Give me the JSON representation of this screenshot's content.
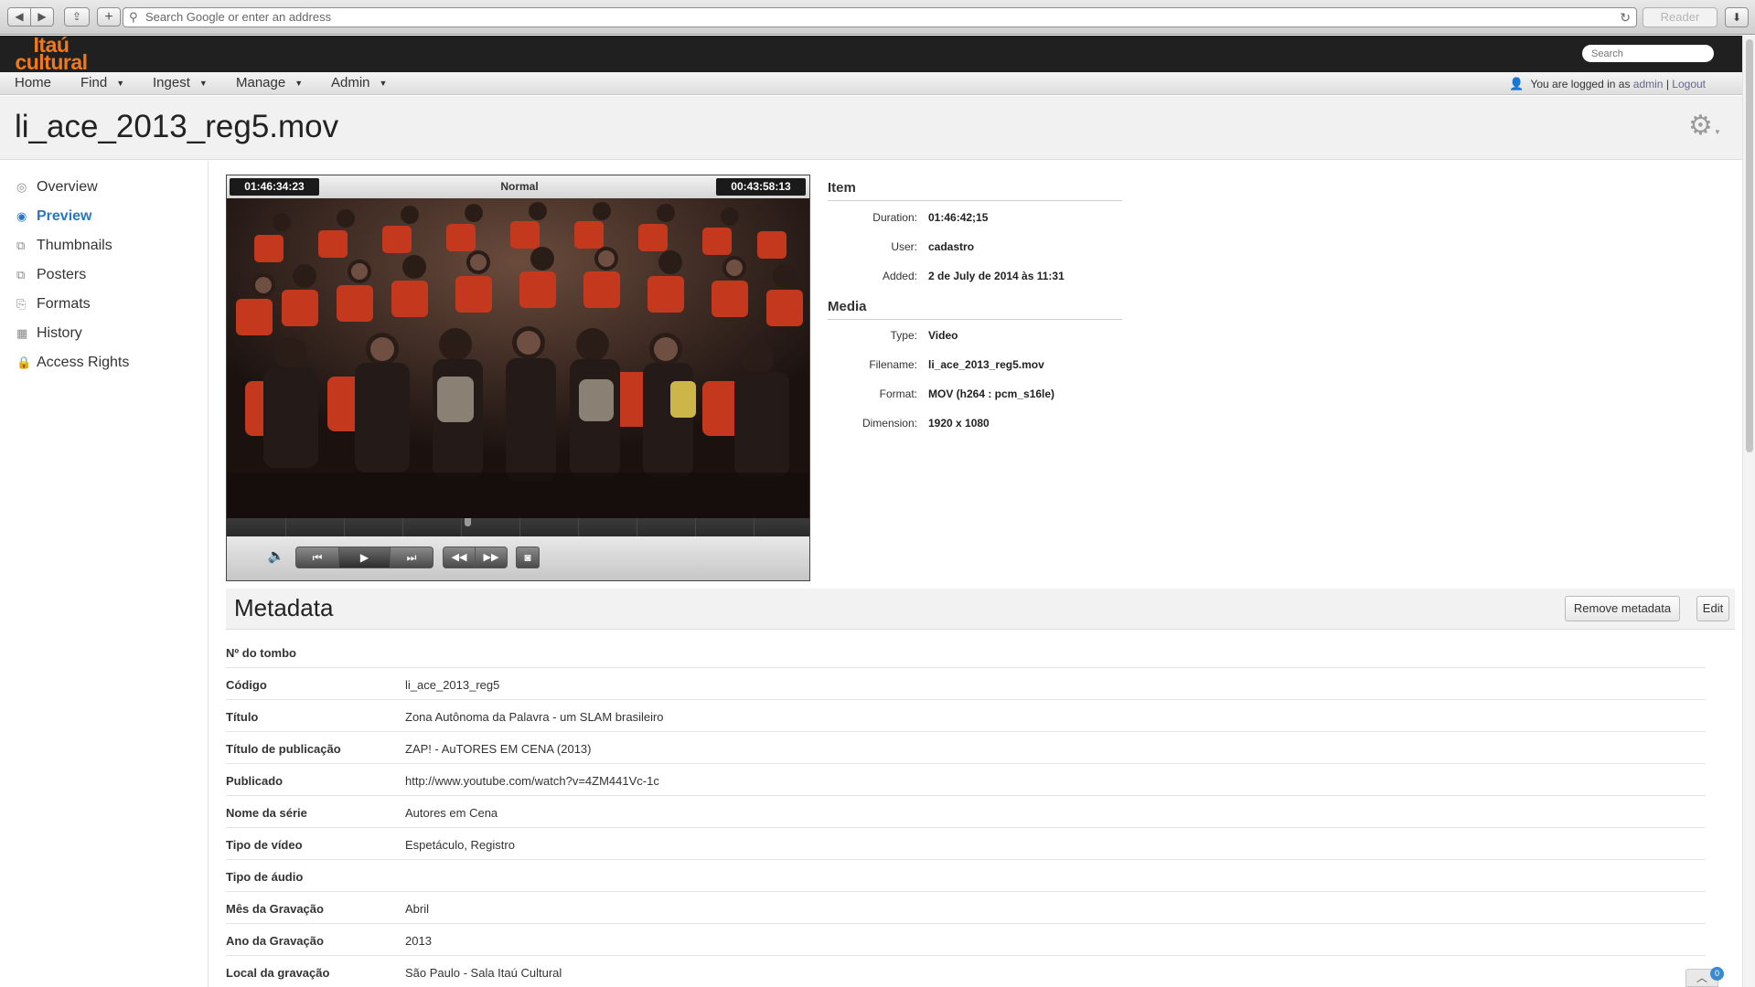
{
  "browser": {
    "address_placeholder": "Search Google or enter an address",
    "reader_label": "Reader"
  },
  "header": {
    "logo_line1": "Itaú",
    "logo_line2": "cultural",
    "search_placeholder": "Search"
  },
  "menu": {
    "home": "Home",
    "find": "Find",
    "ingest": "Ingest",
    "manage": "Manage",
    "admin": "Admin",
    "login_text": "You are logged in as",
    "login_user": "admin",
    "login_sep": "|",
    "logout": "Logout"
  },
  "page": {
    "title": "li_ace_2013_reg5.mov"
  },
  "sidebar": {
    "items": [
      {
        "label": "Overview",
        "icon": "target-icon"
      },
      {
        "label": "Preview",
        "icon": "eye-icon"
      },
      {
        "label": "Thumbnails",
        "icon": "copy-icon"
      },
      {
        "label": "Posters",
        "icon": "copy-icon"
      },
      {
        "label": "Formats",
        "icon": "paperclip-icon"
      },
      {
        "label": "History",
        "icon": "calendar-icon"
      },
      {
        "label": "Access Rights",
        "icon": "lock-icon"
      }
    ],
    "active": "Preview"
  },
  "player": {
    "timecode_left": "01:46:34:23",
    "speed": "Normal",
    "timecode_right": "00:43:58:13"
  },
  "item": {
    "heading": "Item",
    "fields": [
      {
        "label": "Duration:",
        "value": "01:46:42;15"
      },
      {
        "label": "User:",
        "value": "cadastro"
      },
      {
        "label": "Added:",
        "value": "2 de July de 2014 às 11:31"
      }
    ]
  },
  "media": {
    "heading": "Media",
    "fields": [
      {
        "label": "Type:",
        "value": "Video"
      },
      {
        "label": "Filename:",
        "value": "li_ace_2013_reg5.mov"
      },
      {
        "label": "Format:",
        "value": "MOV (h264 : pcm_s16le)"
      },
      {
        "label": "Dimension:",
        "value": "1920 x 1080"
      }
    ]
  },
  "metadata": {
    "heading": "Metadata",
    "remove_label": "Remove metadata",
    "edit_label": "Edit",
    "rows": [
      {
        "key": "Nº do tombo",
        "value": ""
      },
      {
        "key": "Código",
        "value": "li_ace_2013_reg5"
      },
      {
        "key": "Título",
        "value": "Zona Autônoma da Palavra - um SLAM brasileiro"
      },
      {
        "key": "Título de publicação",
        "value": "ZAP! - AuTORES EM CENA (2013)"
      },
      {
        "key": "Publicado",
        "value": "http://www.youtube.com/watch?v=4ZM441Vc-1c"
      },
      {
        "key": "Nome da série",
        "value": "Autores em Cena"
      },
      {
        "key": "Tipo de vídeo",
        "value": "Espetáculo, Registro"
      },
      {
        "key": "Tipo de áudio",
        "value": ""
      },
      {
        "key": "Mês da Gravação",
        "value": "Abril"
      },
      {
        "key": "Ano da Gravação",
        "value": "2013"
      },
      {
        "key": "Local da gravação",
        "value": "São Paulo - Sala Itaú Cultural"
      }
    ]
  },
  "badge": {
    "count": "0"
  },
  "colors": {
    "brand": "#f07a1a",
    "active_link": "#2a76c1",
    "header_bg": "#202020"
  }
}
